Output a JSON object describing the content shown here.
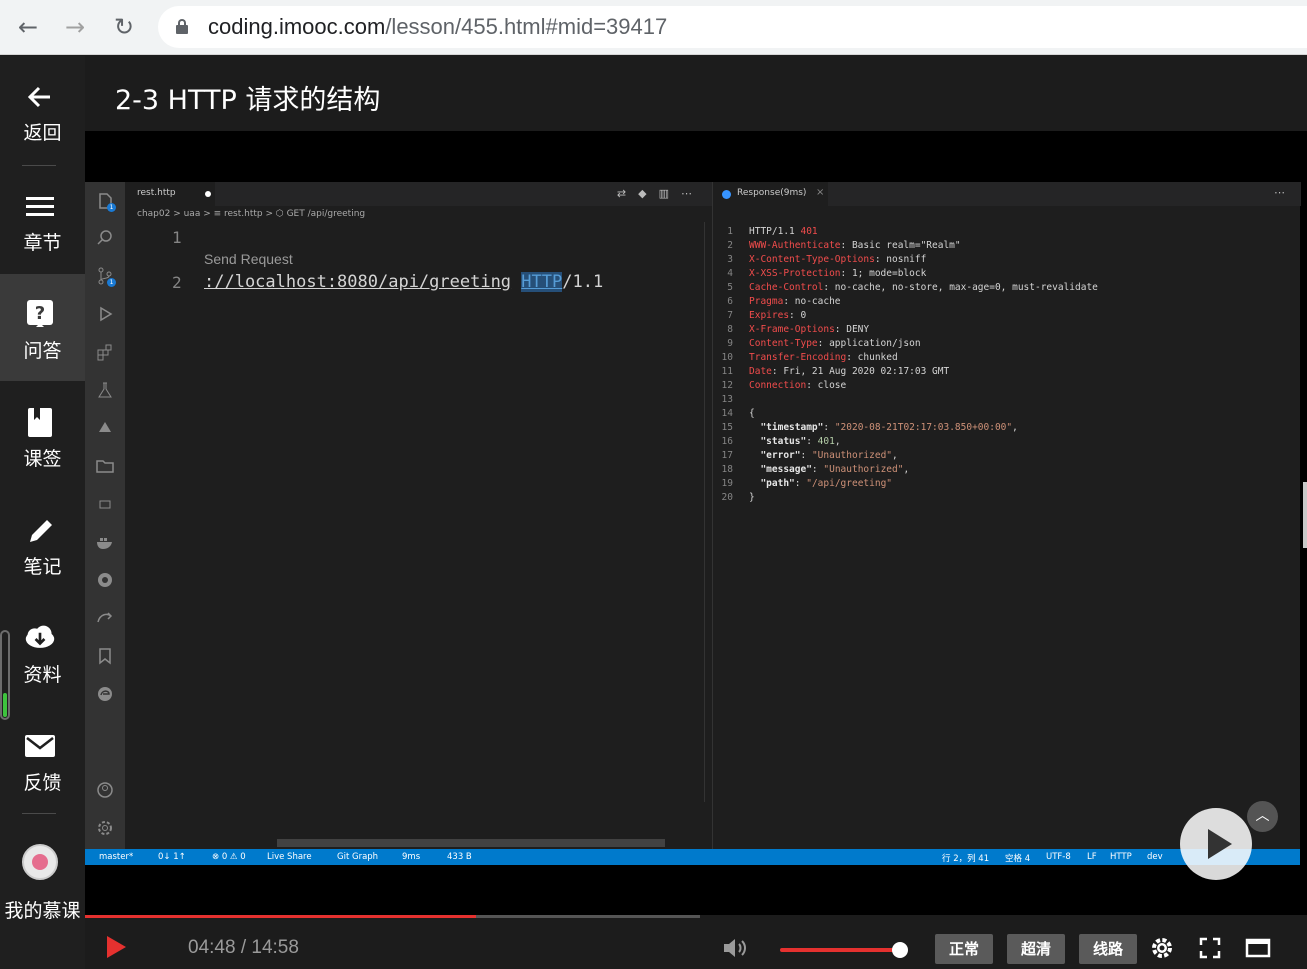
{
  "browser": {
    "back_icon": "←",
    "forward_icon": "→",
    "reload_icon": "↻",
    "url_host": "coding.imooc.com",
    "url_rest": "/lesson/455.html#mid=39417"
  },
  "sidebar": {
    "items": [
      {
        "label": "返回",
        "icon": "back-arrow-icon"
      },
      {
        "label": "章节",
        "icon": "menu-icon"
      },
      {
        "label": "问答",
        "icon": "question-icon"
      },
      {
        "label": "课签",
        "icon": "bookmark-icon"
      },
      {
        "label": "笔记",
        "icon": "pencil-icon"
      },
      {
        "label": "资料",
        "icon": "download-cloud-icon"
      },
      {
        "label": "反馈",
        "icon": "mail-icon"
      },
      {
        "label": "我的慕课",
        "icon": "avatar"
      }
    ]
  },
  "lesson": {
    "title": "2-3 HTTP 请求的结构"
  },
  "vscode": {
    "tab_label": "rest.http",
    "breadcrumb": "chap02 > uaa > ≡ rest.http > ⬡ GET /api/greeting",
    "line1": "1",
    "line2": "2",
    "send_request": "Send Request",
    "code_url": "://localhost:8080/api/greeting",
    "code_http": "HTTP",
    "code_ver": "/1.1",
    "response_tab": "Response(9ms)",
    "response_lines": [
      {
        "n": "1",
        "k": "HTTP/1.1 ",
        "v": "401"
      },
      {
        "n": "2",
        "k": "WWW-Authenticate",
        "v": ": Basic realm=\"Realm\""
      },
      {
        "n": "3",
        "k": "X-Content-Type-Options",
        "v": ": nosniff"
      },
      {
        "n": "4",
        "k": "X-XSS-Protection",
        "v": ": 1; mode=block"
      },
      {
        "n": "5",
        "k": "Cache-Control",
        "v": ": no-cache, no-store, max-age=0, must-revalidate"
      },
      {
        "n": "6",
        "k": "Pragma",
        "v": ": no-cache"
      },
      {
        "n": "7",
        "k": "Expires",
        "v": ": 0"
      },
      {
        "n": "8",
        "k": "X-Frame-Options",
        "v": ": DENY"
      },
      {
        "n": "9",
        "k": "Content-Type",
        "v": ": application/json"
      },
      {
        "n": "10",
        "k": "Transfer-Encoding",
        "v": ": chunked"
      },
      {
        "n": "11",
        "k": "Date",
        "v": ": Fri, 21 Aug 2020 02:17:03 GMT"
      },
      {
        "n": "12",
        "k": "Connection",
        "v": ": close"
      },
      {
        "n": "13",
        "k": "",
        "v": ""
      },
      {
        "n": "14",
        "k": "",
        "v": "{"
      },
      {
        "n": "15",
        "k": "  \"timestamp\"",
        "v": ": \"2020-08-21T02:17:03.850+00:00\","
      },
      {
        "n": "16",
        "k": "  \"status\"",
        "v": ": 401,"
      },
      {
        "n": "17",
        "k": "  \"error\"",
        "v": ": \"Unauthorized\","
      },
      {
        "n": "18",
        "k": "  \"message\"",
        "v": ": \"Unauthorized\","
      },
      {
        "n": "19",
        "k": "  \"path\"",
        "v": ": \"/api/greeting\""
      },
      {
        "n": "20",
        "k": "",
        "v": "}"
      }
    ],
    "status": {
      "branch": "master*",
      "sync": "0↓ 1↑",
      "problems": "⊗ 0 ⚠ 0",
      "live_share": "Live Share",
      "git_graph": "Git Graph",
      "timing": "9ms",
      "size": "433 B",
      "position": "行 2，列 41",
      "spaces": "空格 4",
      "encoding": "UTF-8",
      "eol": "LF",
      "lang": "HTTP",
      "env": "dev"
    }
  },
  "player": {
    "current_time": "04:48",
    "sep": " / ",
    "duration": "14:58",
    "progress": 0.32,
    "volume": 0.95,
    "quality_normal": "正常",
    "quality_hd": "超清",
    "route": "线路"
  },
  "colors": {
    "accent": "#e5312f",
    "vscode_blue": "#007acc"
  }
}
